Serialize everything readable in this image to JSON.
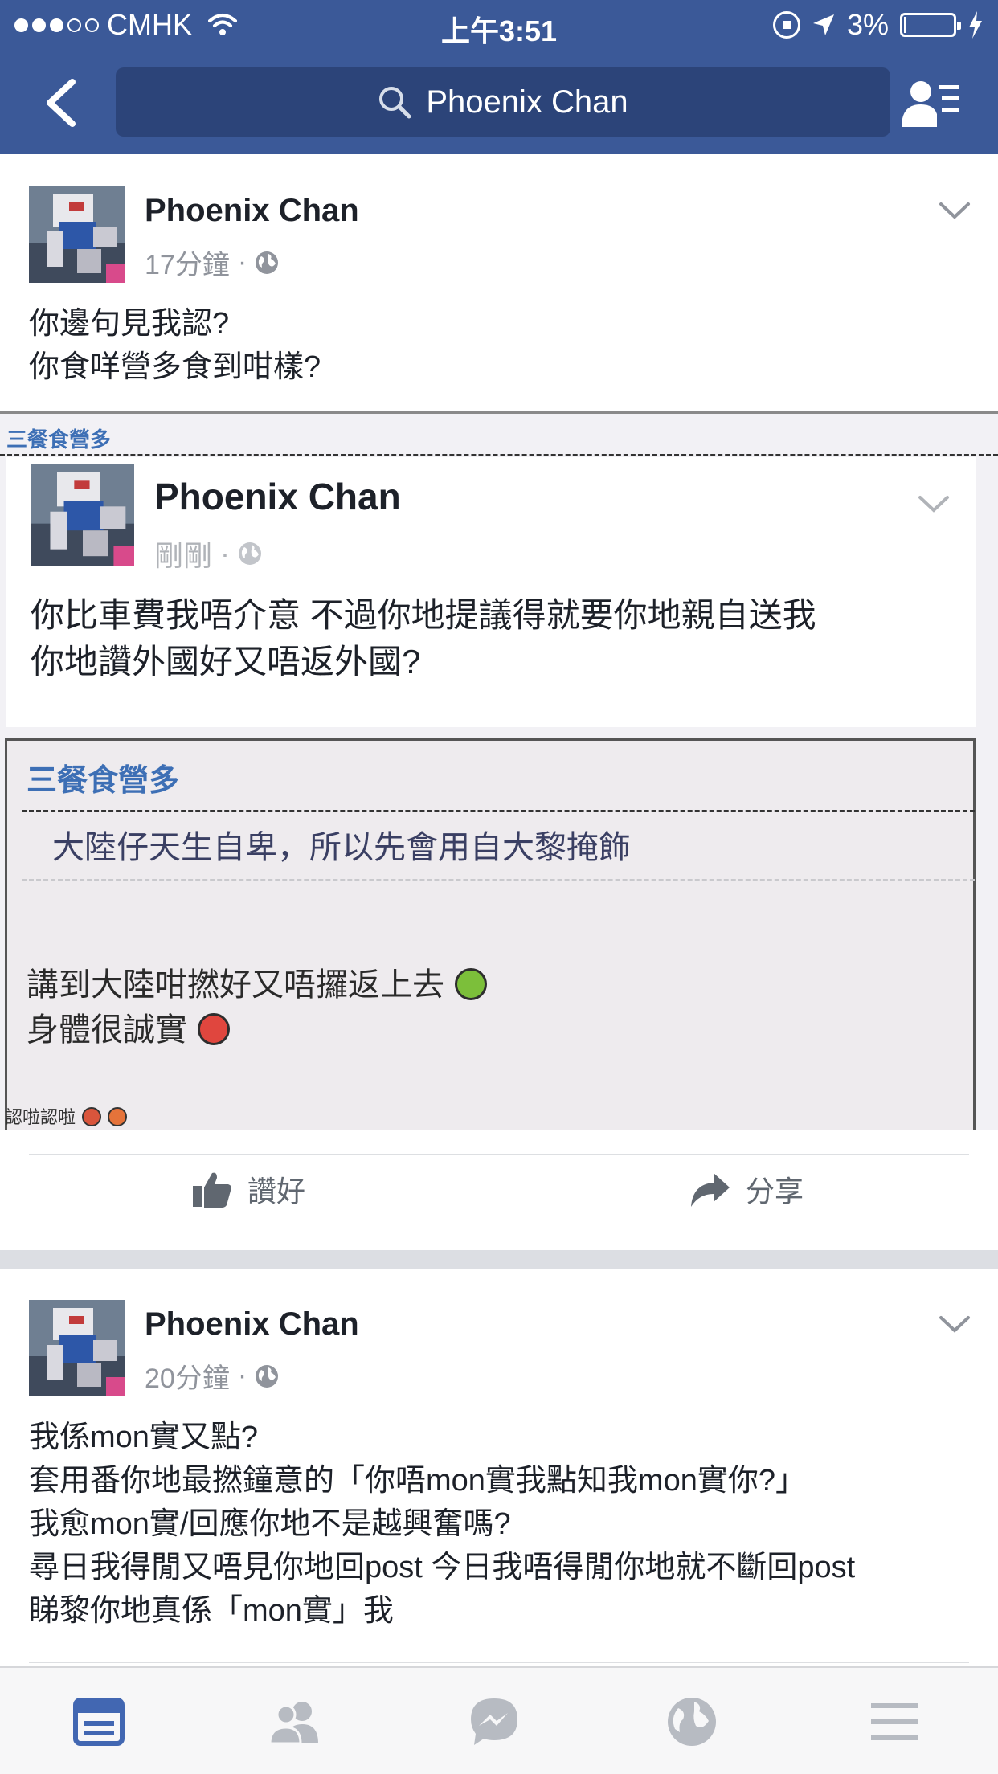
{
  "status_bar": {
    "carrier": "CMHK",
    "time": "上午3:51",
    "battery_text": "3%",
    "battery_level": 0.03
  },
  "nav": {
    "search_value": "Phoenix Chan"
  },
  "posts": [
    {
      "author": "Phoenix Chan",
      "time": "17分鐘",
      "separator": "·",
      "text": "你邊句見我認?\n你食咩營多食到咁樣?",
      "shared_image": {
        "group_label_top": "三餐食營多",
        "inner_author": "Phoenix Chan",
        "inner_time": "剛剛",
        "inner_separator": "·",
        "inner_text": "你比車費我唔介意 不過你地提議得就要你地親自送我\n你地讚外國好又唔返外國?",
        "box_label": "三餐食營多",
        "box_line": "大陸仔天生自卑，所以先會用自大黎掩飾",
        "box_text_1": "講到大陸咁撚好又唔攞返上去",
        "box_text_2": "身體很誠實",
        "footnote": "認啦認啦"
      },
      "actions": {
        "like": "讚好",
        "share": "分享"
      }
    },
    {
      "author": "Phoenix Chan",
      "time": "20分鐘",
      "separator": "·",
      "text": "我係mon實又點?\n套用番你地最撚鐘意的「你唔mon實我點知我mon實你?」\n我愈mon實/回應你地不是越興奮嗎?\n尋日我得閒又唔見你地回post 今日我唔得閒你地就不斷回post\n睇黎你地真係「mon實」我"
    }
  ],
  "tabs": [
    "news-feed",
    "friend-requests",
    "messenger",
    "notifications",
    "more"
  ],
  "colors": {
    "header": "#3b5998",
    "search_bg": "#2c4479",
    "active_tab": "#4267b2",
    "inactive_tab": "#b7bbc2"
  }
}
